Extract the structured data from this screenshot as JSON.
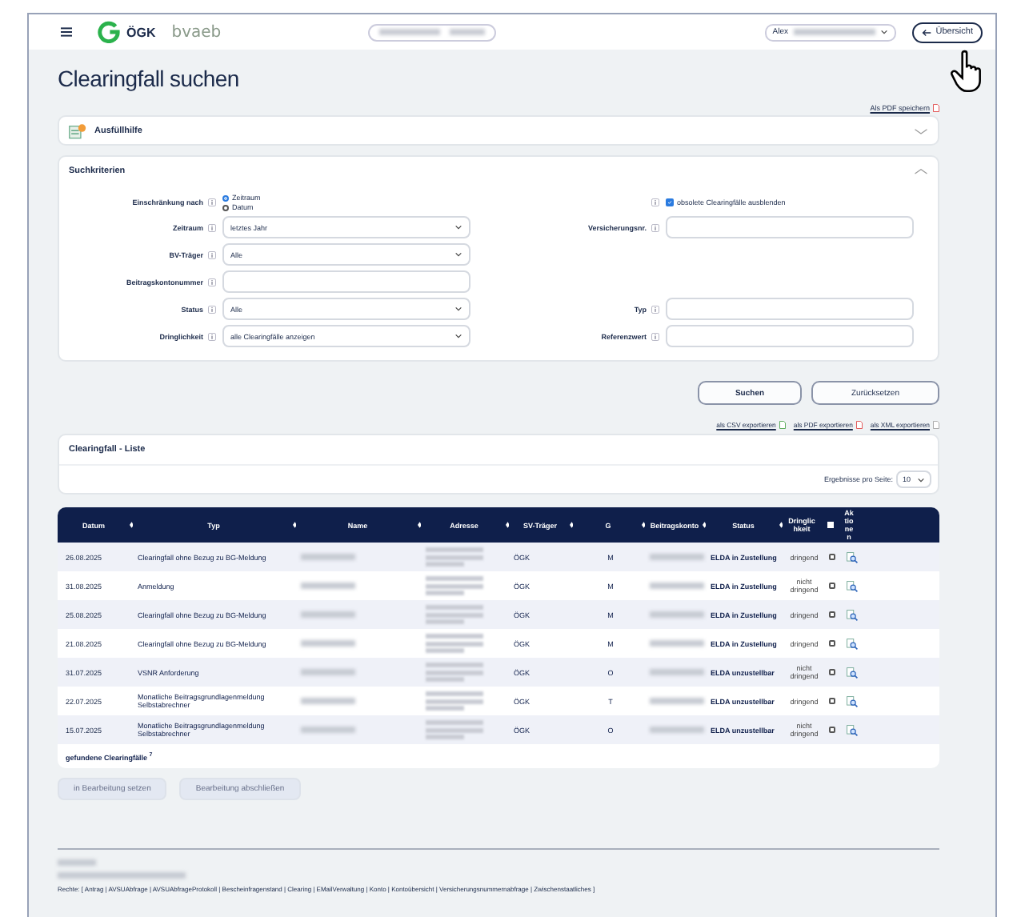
{
  "header": {
    "logo_text": "ÖGK",
    "brand_text": "bvaeb",
    "user": "Alex",
    "back_button": "Übersicht"
  },
  "page_title": "Clearingfall suchen",
  "pdf_link": "Als PDF speichern",
  "help_panel": {
    "title": "Ausfüllhilfe",
    "expanded": false
  },
  "criteria": {
    "title": "Suchkriterien",
    "expanded": true,
    "restriction": {
      "label": "Einschränkung nach",
      "options": [
        {
          "label": "Zeitraum",
          "selected": true
        },
        {
          "label": "Datum",
          "selected": false
        }
      ]
    },
    "hide_obsolete": {
      "label": "obsolete Clearingfälle ausblenden",
      "checked": true
    },
    "form_rows": [
      {
        "left": {
          "label": "Zeitraum",
          "kind": "select",
          "value": "letztes Jahr"
        },
        "right": {
          "label": "Versicherungsnr.",
          "kind": "input"
        }
      },
      {
        "left": {
          "label": "BV-Träger",
          "kind": "select",
          "value": "Alle"
        }
      },
      {
        "left": {
          "label": "Beitragskontonummer",
          "kind": "input"
        }
      },
      {
        "left": {
          "label": "Status",
          "kind": "select",
          "value": "Alle"
        },
        "right": {
          "label": "Typ",
          "kind": "input"
        }
      },
      {
        "left": {
          "label": "Dringlichkeit",
          "kind": "select",
          "value": "alle Clearingfälle anzeigen"
        },
        "right": {
          "label": "Referenzwert",
          "kind": "input"
        }
      }
    ]
  },
  "actions": [
    "Suchen",
    "Zurücksetzen"
  ],
  "exports": [
    "als CSV exportieren",
    "als PDF exportieren",
    "als XML exportieren"
  ],
  "list_panel": {
    "title": "Clearingfall - Liste",
    "page_size_label": "Ergebnisse pro Seite:",
    "page_size": "10"
  },
  "table": {
    "columns": [
      "Datum",
      "Typ",
      "Name",
      "Adresse",
      "SV-Träger",
      "G",
      "Beitragskonto",
      "Status",
      "Dringlichkeit",
      "Aktionen"
    ],
    "select_all_checked": false,
    "rows": [
      {
        "date": "26.08.2025",
        "type": "Clearingfall ohne Bezug zu BG-Meldung",
        "carrier": "ÖGK",
        "g": "M",
        "status": "ELDA in Zustellung",
        "urgency": "dringend",
        "checked": false
      },
      {
        "date": "31.08.2025",
        "type": "Anmeldung",
        "carrier": "ÖGK",
        "g": "M",
        "status": "ELDA in Zustellung",
        "urgency": "nicht dringend",
        "checked": false
      },
      {
        "date": "25.08.2025",
        "type": "Clearingfall ohne Bezug zu BG-Meldung",
        "carrier": "ÖGK",
        "g": "M",
        "status": "ELDA in Zustellung",
        "urgency": "dringend",
        "checked": false
      },
      {
        "date": "21.08.2025",
        "type": "Clearingfall ohne Bezug zu BG-Meldung",
        "carrier": "ÖGK",
        "g": "M",
        "status": "ELDA in Zustellung",
        "urgency": "dringend",
        "checked": false
      },
      {
        "date": "31.07.2025",
        "type": "VSNR Anforderung",
        "carrier": "ÖGK",
        "g": "O",
        "status": "ELDA unzustellbar",
        "urgency": "nicht dringend",
        "checked": false
      },
      {
        "date": "22.07.2025",
        "type": "Monatliche Beitragsgrundlagenmeldung Selbstabrechner",
        "carrier": "ÖGK",
        "g": "T",
        "status": "ELDA unzustellbar",
        "urgency": "dringend",
        "checked": false
      },
      {
        "date": "15.07.2025",
        "type": "Monatliche Beitragsgrundlagenmeldung Selbstabrechner",
        "carrier": "ÖGK",
        "g": "O",
        "status": "ELDA unzustellbar",
        "urgency": "nicht dringend",
        "checked": false
      }
    ],
    "found_label": "gefundene Clearingfälle",
    "found_count": "7"
  },
  "bulk_buttons": [
    {
      "label": "in Bearbeitung setzen",
      "disabled": true
    },
    {
      "label": "Bearbeitung abschließen",
      "disabled": true
    }
  ],
  "footer": {
    "rights": "Rechte: [ Antrag | AVSUAbfrage | AVSUAbfrageProtokoll | Bescheinfragenstand | Clearing | EMailVerwaltung | Konto | Kontoübersicht | Versicherungsnummernabfrage | Zwischenstaatliches ]"
  }
}
